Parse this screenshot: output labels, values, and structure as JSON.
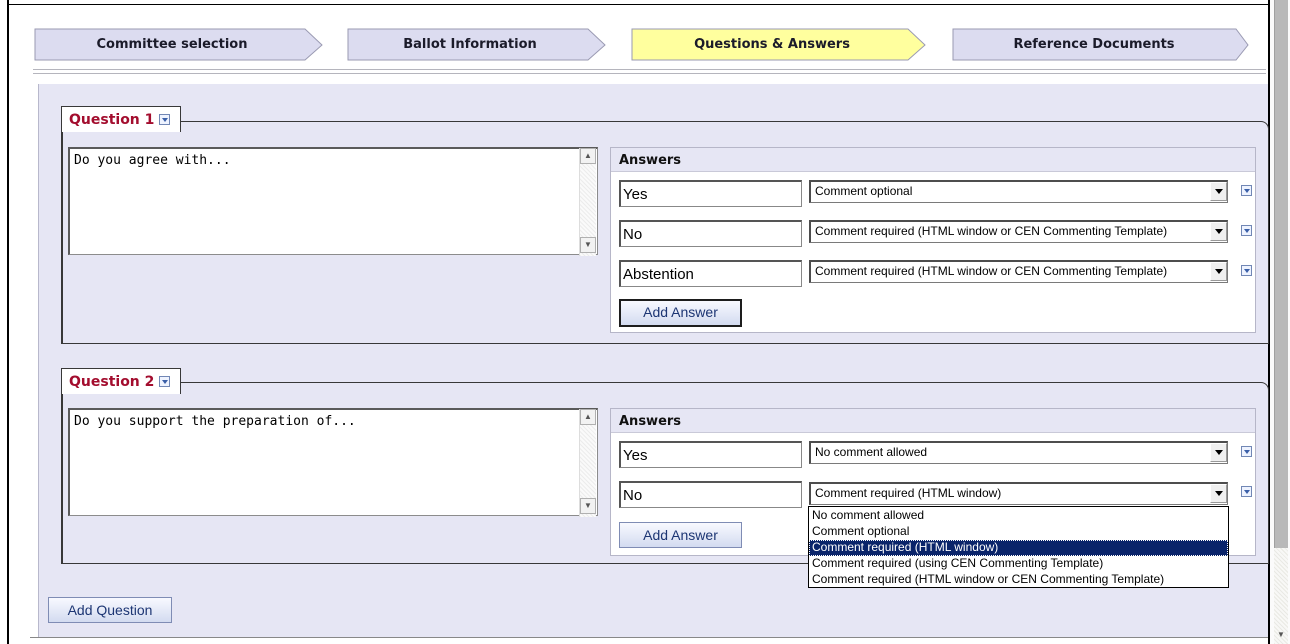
{
  "wizard": {
    "steps": [
      {
        "label": "Committee selection",
        "active": false
      },
      {
        "label": "Ballot Information",
        "active": false
      },
      {
        "label": "Questions & Answers",
        "active": true
      },
      {
        "label": "Reference Documents",
        "active": false
      }
    ]
  },
  "questions": [
    {
      "title": "Question 1",
      "text": "Do you agree with...",
      "answers_header": "Answers",
      "answers": [
        {
          "value": "Yes",
          "comment": "Comment optional"
        },
        {
          "value": "No",
          "comment": "Comment required (HTML window or CEN Commenting Template)"
        },
        {
          "value": "Abstention",
          "comment": "Comment required (HTML window or CEN Commenting Template)"
        }
      ],
      "add_answer_label": "Add Answer"
    },
    {
      "title": "Question 2",
      "text": "Do you support the preparation of...",
      "answers_header": "Answers",
      "answers": [
        {
          "value": "Yes",
          "comment": "No comment allowed"
        },
        {
          "value": "No",
          "comment": "Comment required (HTML window)"
        }
      ],
      "add_answer_label": "Add Answer"
    }
  ],
  "comment_options": [
    "No comment allowed",
    "Comment optional",
    "Comment required (HTML window)",
    "Comment required (using CEN Commenting Template)",
    "Comment required (HTML window or CEN Commenting Template)"
  ],
  "open_dropdown_selected": "Comment required (HTML window)",
  "add_question_label": "Add Question",
  "colors": {
    "active_step": "#ffff9e",
    "inactive_step": "#dcdcf0",
    "panel_background": "#e6e6f4",
    "question_title": "#a30d2e",
    "selected_option": "#0a246a"
  }
}
